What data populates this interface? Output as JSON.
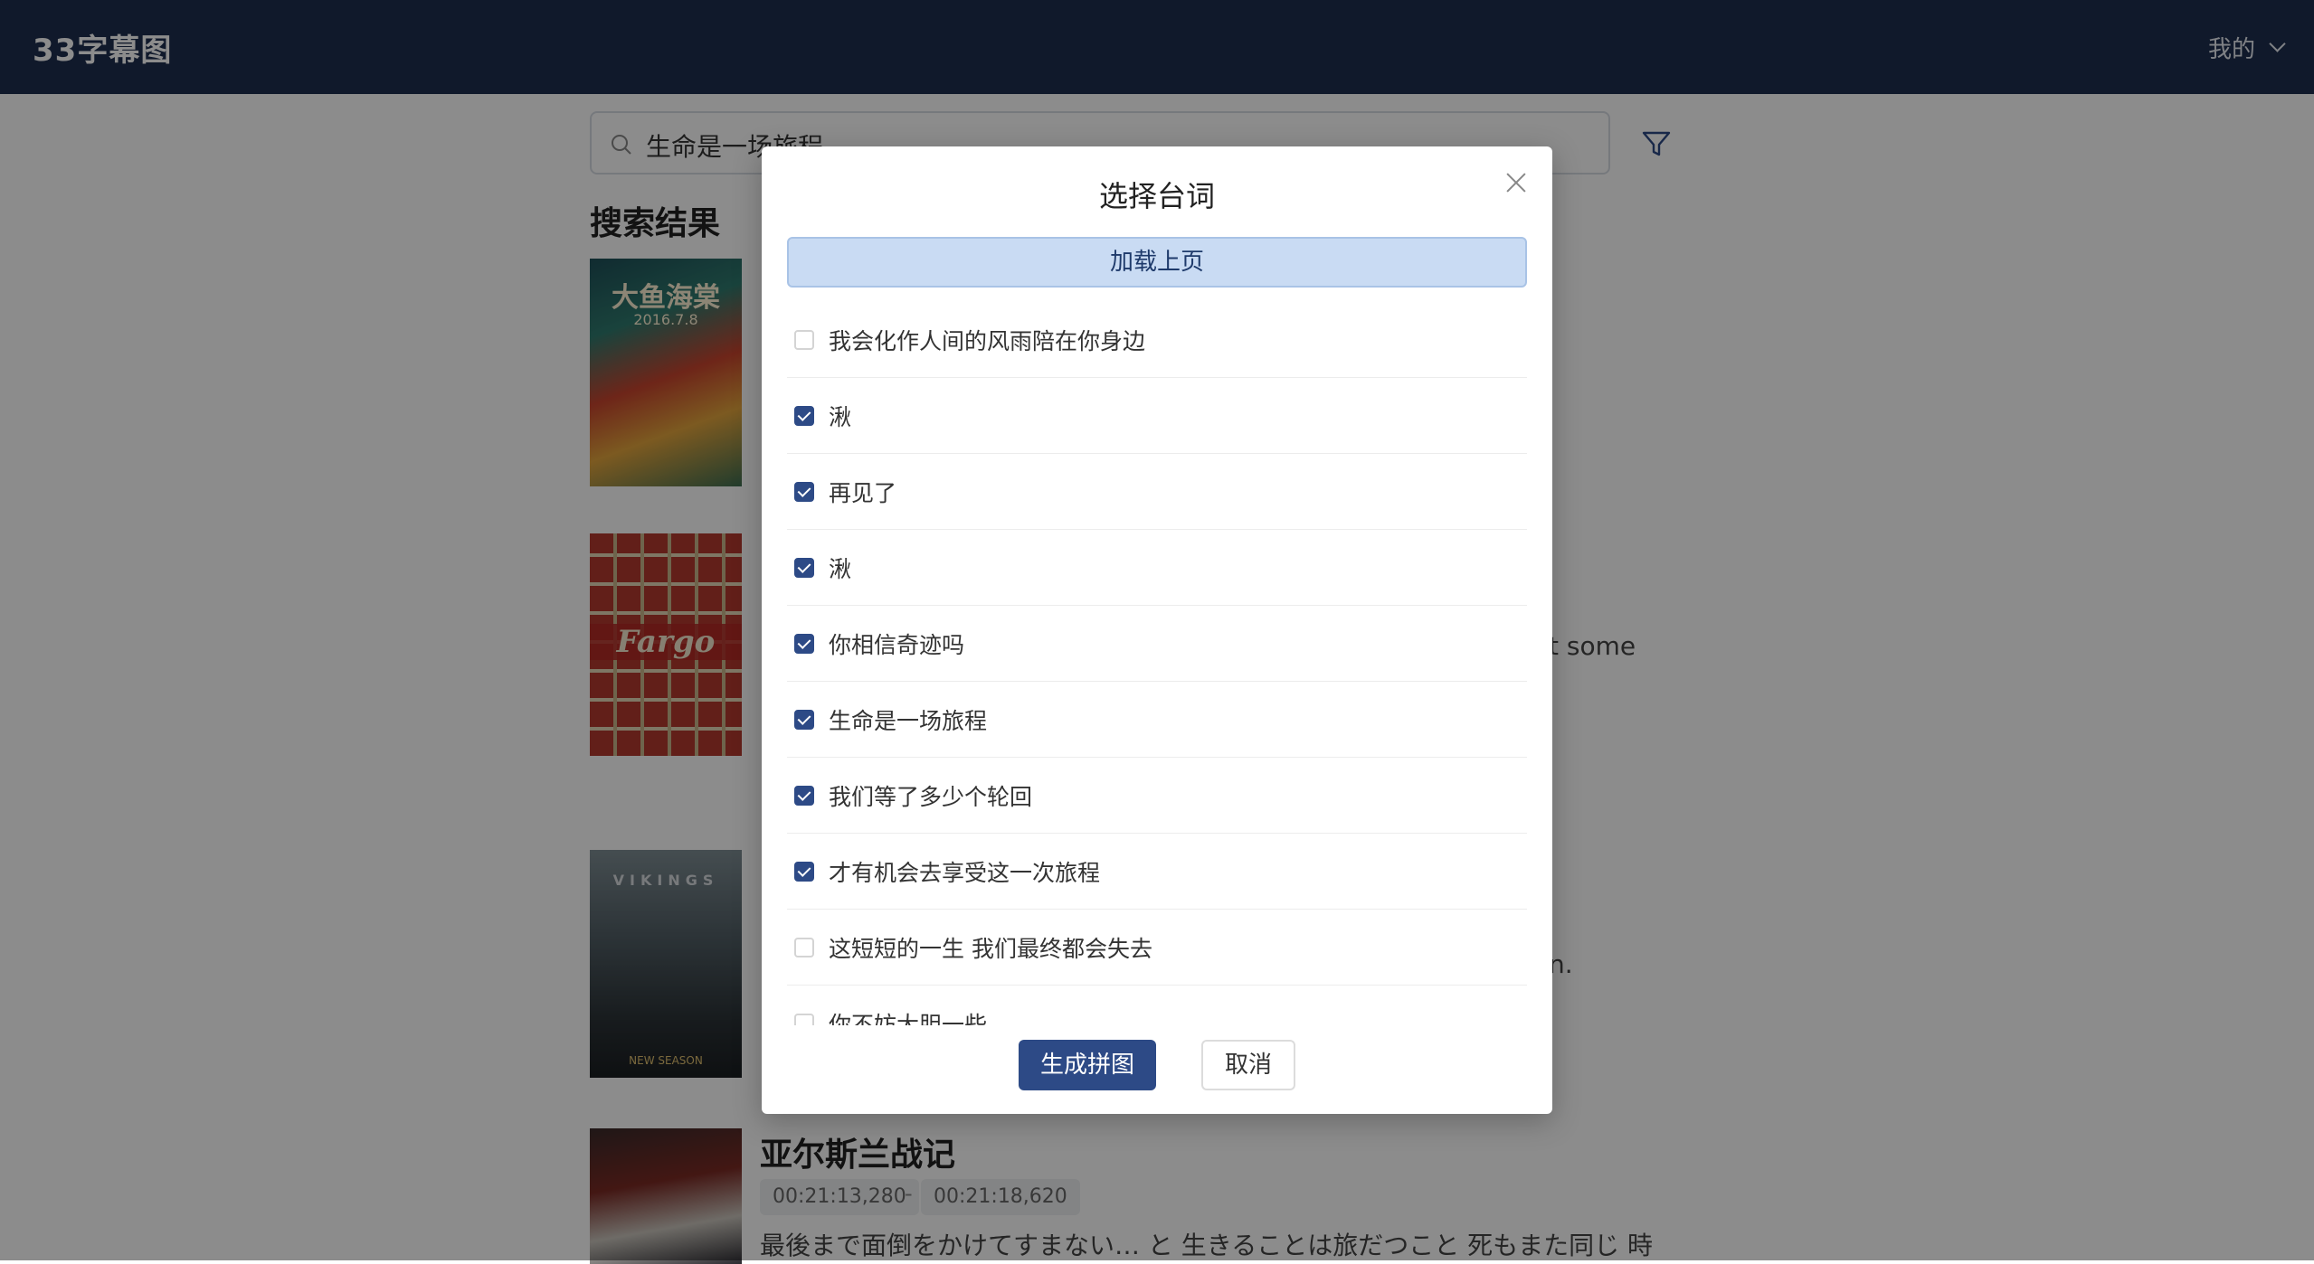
{
  "header": {
    "app_title": "33字幕图",
    "user_menu_label": "我的"
  },
  "search": {
    "value": "生命是一场旅程"
  },
  "results": {
    "section_title": "搜索结果",
    "posters": [
      {
        "label": "大鱼海棠",
        "sub": "2016.7.8"
      },
      {
        "label": "Fargo"
      },
      {
        "label": "VIKINGS",
        "sub": "NEW SEASON"
      },
      {
        "label": ""
      }
    ],
    "bg_fragment_1": "t some",
    "bg_fragment_2": "n.",
    "last": {
      "title": "亚尔斯兰战记",
      "time_start": "00:21:13,280",
      "time_sep": "-",
      "time_end": "00:21:18,620",
      "snippet": "最後まで面倒をかけてすまない…  と 生きることは旅だつこと   死もまた同じ 時"
    }
  },
  "modal": {
    "title": "选择台词",
    "load_prev_label": "加载上页",
    "lines": [
      {
        "text": "我会化作人间的风雨陪在你身边",
        "checked": false
      },
      {
        "text": "湫",
        "checked": true
      },
      {
        "text": "再见了",
        "checked": true
      },
      {
        "text": "湫",
        "checked": true
      },
      {
        "text": "你相信奇迹吗",
        "checked": true
      },
      {
        "text": "生命是一场旅程",
        "checked": true
      },
      {
        "text": "我们等了多少个轮回",
        "checked": true
      },
      {
        "text": "才有机会去享受这一次旅程",
        "checked": true
      },
      {
        "text": "这短短的一生 我们最终都会失去",
        "checked": false
      },
      {
        "text": "你不妨大胆一些",
        "checked": false
      }
    ],
    "generate_label": "生成拼图",
    "cancel_label": "取消"
  },
  "colors": {
    "header_bg": "#1e2e4f",
    "primary": "#2d4a86",
    "load_prev_bg": "#c9dbf3"
  }
}
